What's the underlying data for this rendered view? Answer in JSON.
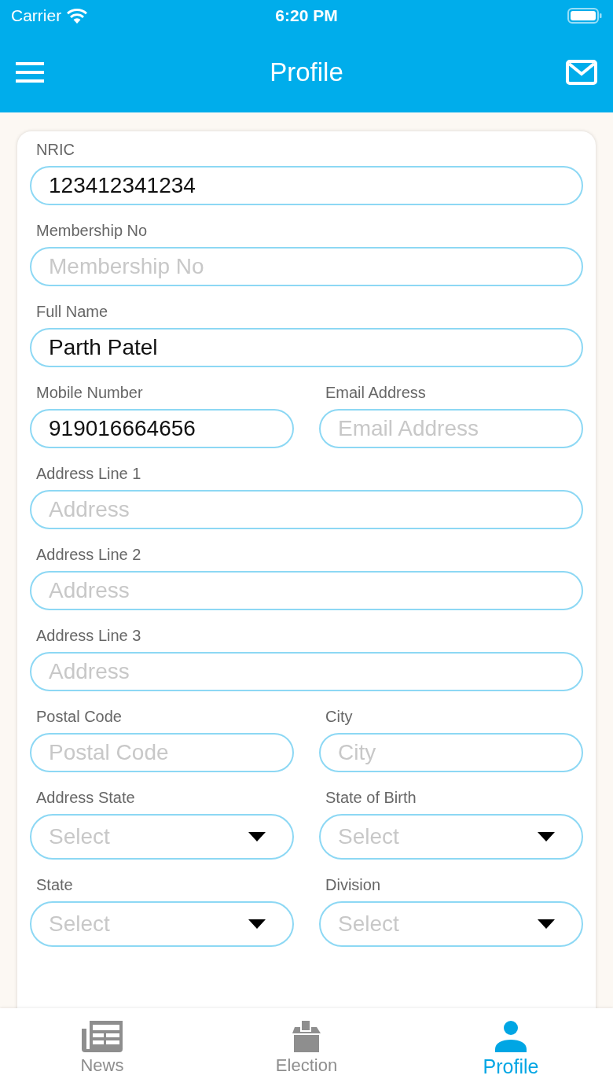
{
  "status_bar": {
    "carrier": "Carrier",
    "time": "6:20 PM"
  },
  "header": {
    "title": "Profile"
  },
  "form": {
    "rows": [
      {
        "fields": [
          {
            "label": "NRIC",
            "kind": "text",
            "value": "123412341234"
          }
        ]
      },
      {
        "fields": [
          {
            "label": "Membership No",
            "kind": "text",
            "placeholder": "Membership No"
          }
        ]
      },
      {
        "fields": [
          {
            "label": "Full Name",
            "kind": "text",
            "value": "Parth Patel"
          }
        ]
      },
      {
        "fields": [
          {
            "label": "Mobile Number",
            "kind": "text",
            "value": "919016664656"
          },
          {
            "label": "Email Address",
            "kind": "text",
            "placeholder": "Email Address"
          }
        ]
      },
      {
        "fields": [
          {
            "label": "Address Line 1",
            "kind": "text",
            "placeholder": "Address"
          }
        ]
      },
      {
        "fields": [
          {
            "label": "Address Line 2",
            "kind": "text",
            "placeholder": "Address"
          }
        ]
      },
      {
        "fields": [
          {
            "label": "Address Line 3",
            "kind": "text",
            "placeholder": "Address"
          }
        ]
      },
      {
        "fields": [
          {
            "label": "Postal Code",
            "kind": "text",
            "placeholder": "Postal Code"
          },
          {
            "label": "City",
            "kind": "text",
            "placeholder": "City"
          }
        ]
      },
      {
        "fields": [
          {
            "label": "Address State",
            "kind": "select",
            "placeholder": "Select"
          },
          {
            "label": "State of Birth",
            "kind": "select",
            "placeholder": "Select"
          }
        ]
      },
      {
        "fields": [
          {
            "label": "State",
            "kind": "select",
            "placeholder": "Select"
          },
          {
            "label": "Division",
            "kind": "select",
            "placeholder": "Select"
          }
        ]
      }
    ]
  },
  "tab_bar": {
    "tabs": [
      {
        "label": "News",
        "kind": "news",
        "selected": false
      },
      {
        "label": "Election",
        "kind": "election",
        "selected": false
      },
      {
        "label": "Profile",
        "kind": "profile",
        "selected": true
      }
    ]
  }
}
